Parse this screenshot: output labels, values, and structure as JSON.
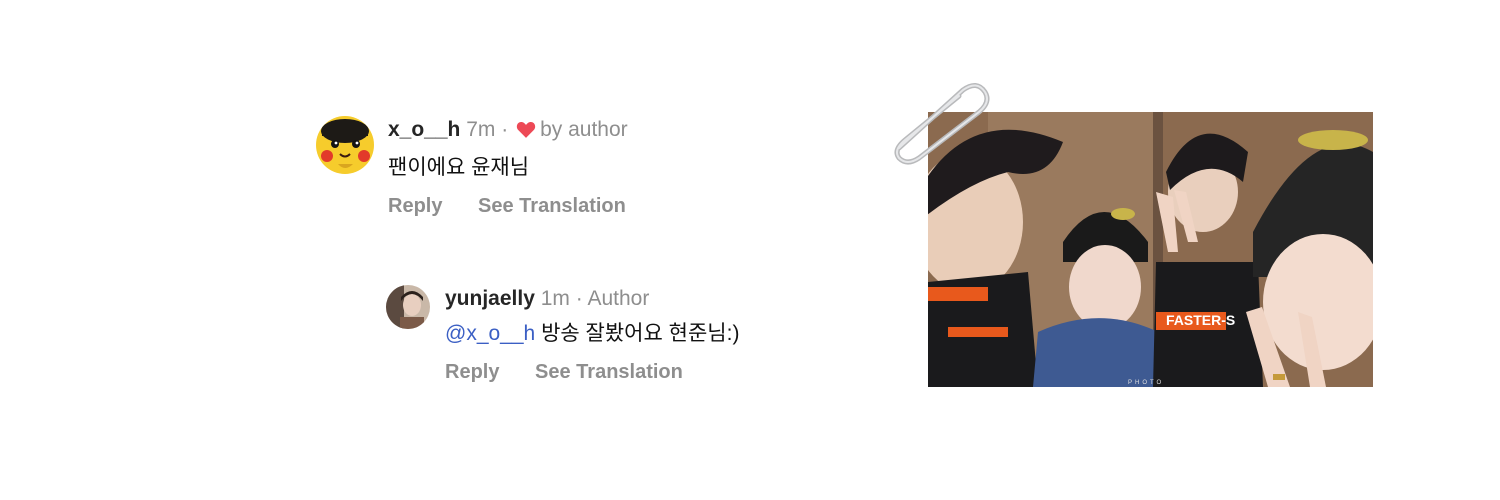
{
  "comment1": {
    "username": "x_o__h",
    "time": "7m",
    "separator": "·",
    "liked_label": "by author",
    "text": "팬이에요 윤재님",
    "reply_label": "Reply",
    "translate_label": "See Translation",
    "avatar_icon": "pikachu-avatar"
  },
  "comment2": {
    "username": "yunjaelly",
    "time": "1m",
    "separator": "·",
    "author_badge": "Author",
    "mention": "@x_o__h",
    "text": "방송 잘봤어요 현준님:)",
    "reply_label": "Reply",
    "translate_label": "See Translation"
  },
  "photo": {
    "jacket_print": "FASTER-S",
    "watermark": "PHOTO"
  },
  "colors": {
    "heart": "#ed4956",
    "mention": "#3b5fc4",
    "muted": "#8e8e8e"
  }
}
